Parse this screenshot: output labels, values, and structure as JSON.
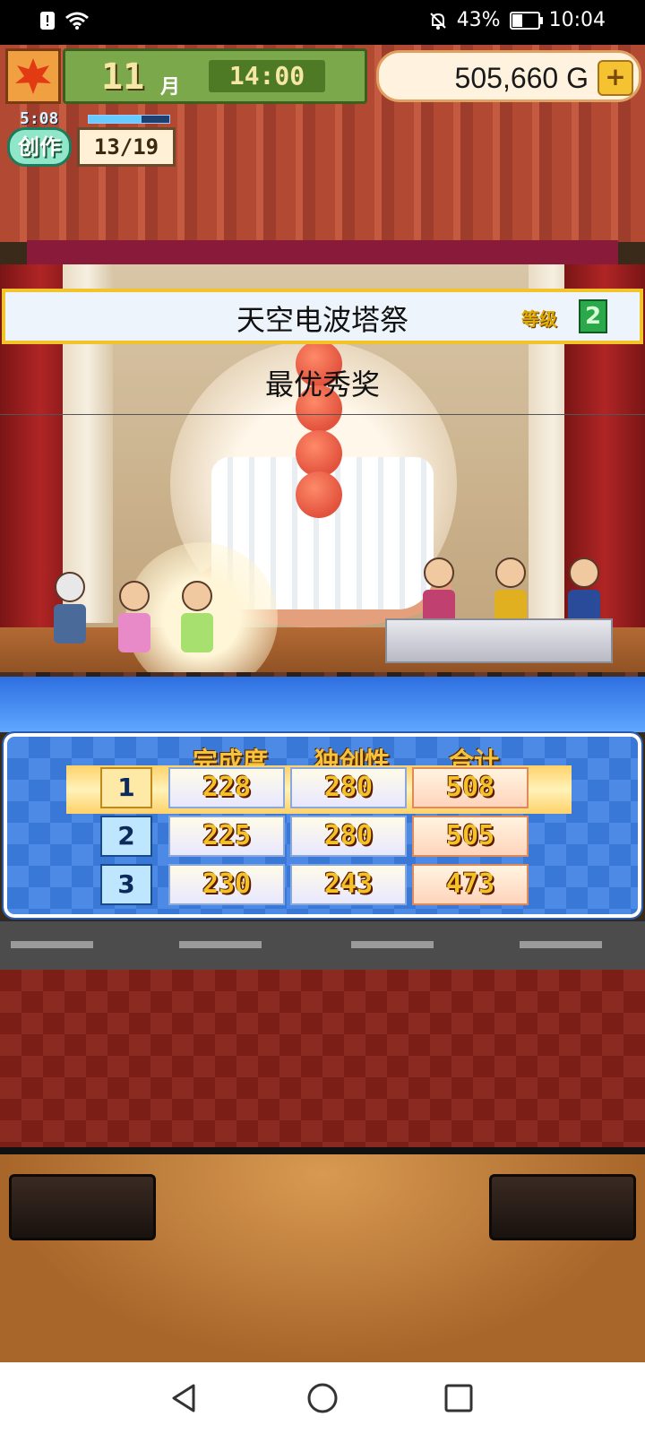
{
  "status_bar": {
    "battery_percent": "43%",
    "battery_level": 0.43,
    "time": "10:04",
    "icons": [
      "alert-icon",
      "wifi-icon",
      "mute-bell-icon",
      "battery-icon"
    ]
  },
  "hud": {
    "month_number": "11",
    "month_label": "月",
    "clock": "14:00",
    "money": "505,660 G",
    "add_money_label": "+",
    "season_icon": "maple-leaf-icon"
  },
  "create": {
    "timer": "5:08",
    "label": "创作",
    "count": "13/19",
    "progress": 0.65
  },
  "event": {
    "name": "天空电波塔祭",
    "level_label": "等级",
    "level_value": "2",
    "award": "最优秀奖"
  },
  "scores": {
    "headers": [
      "完成度",
      "独创性",
      "合计"
    ],
    "rows": [
      {
        "rank": "1",
        "completion": "228",
        "originality": "280",
        "total": "508"
      },
      {
        "rank": "2",
        "completion": "225",
        "originality": "280",
        "total": "505"
      },
      {
        "rank": "3",
        "completion": "230",
        "originality": "243",
        "total": "473"
      }
    ]
  },
  "colors": {
    "accent_gold": "#f2c228",
    "panel_blue": "#3a78d8",
    "banner_border": "#f2c42a"
  }
}
